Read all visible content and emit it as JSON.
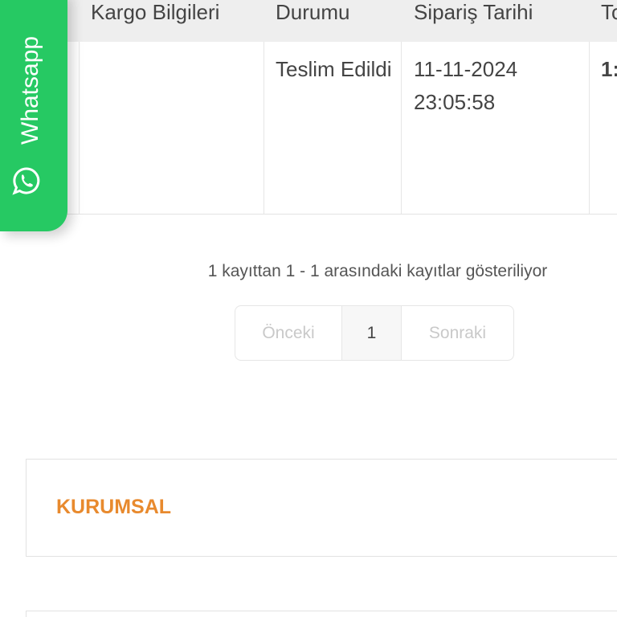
{
  "table": {
    "headers": [
      "Kargo Bilgileri",
      "Durumu",
      "Sipariş Tarihi",
      "To"
    ],
    "row": {
      "durum": "Teslim Edildi",
      "tarih": "11-11-2024 23:05:58",
      "toplam": "1:"
    }
  },
  "whatsapp": {
    "label": "Whatsapp",
    "icon": "whatsapp-icon",
    "color": "#26c963"
  },
  "info_text": "1 kayıttan 1 - 1 arasındaki kayıtlar gösteriliyor",
  "pagination": {
    "prev": "Önceki",
    "current": "1",
    "next": "Sonraki"
  },
  "footer": {
    "section_title": "KURUMSAL",
    "accent": "#e88a2e"
  }
}
